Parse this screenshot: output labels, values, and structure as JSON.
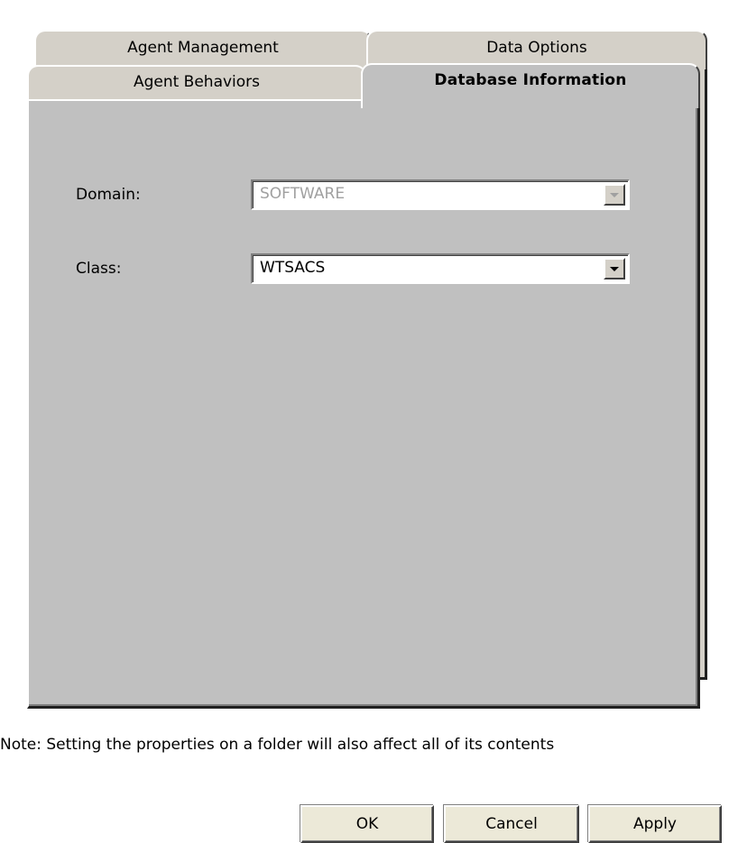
{
  "tabs": {
    "back_row": [
      {
        "label": "Agent Management"
      },
      {
        "label": "Data Options"
      }
    ],
    "front_row": [
      {
        "label": "Agent Behaviors"
      },
      {
        "label": "Database Information",
        "active": true
      }
    ]
  },
  "form": {
    "domain": {
      "label": "Domain:",
      "value": "SOFTWARE",
      "disabled": true
    },
    "class": {
      "label": "Class:",
      "value": "WTSACS",
      "disabled": false
    }
  },
  "note": "Note: Setting the properties on a folder will also affect all of its contents",
  "buttons": {
    "ok": "OK",
    "cancel": "Cancel",
    "apply": "Apply"
  },
  "icons": {
    "dropdown": "chevron-down-icon"
  },
  "colors": {
    "panel_bg": "#c0c0c0",
    "tab_bg": "#d4d0c8",
    "button_bg": "#ece9d8",
    "disabled_text": "#a0a0a0"
  }
}
